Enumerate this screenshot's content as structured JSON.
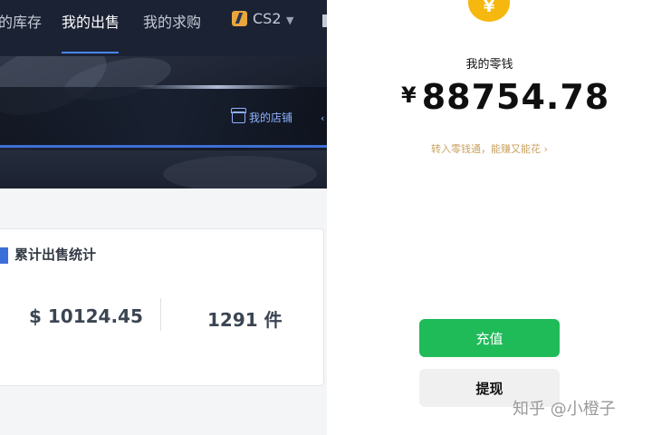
{
  "left_panel": {
    "nav": {
      "items": [
        "的库存",
        "我的出售",
        "我的求购"
      ],
      "active_index": 1,
      "game_selector": "CS2"
    },
    "banner": {
      "shop_link": "我的店铺"
    },
    "stats_card": {
      "title": "累计出售统计",
      "total_amount": "$ 10124.45",
      "total_count": "1291 件"
    }
  },
  "right_panel": {
    "coin_symbol": "¥",
    "wallet_label": "我的零钱",
    "balance_currency": "¥",
    "balance_amount": "88754.78",
    "promo_link": "转入零钱通，能赚又能花 ›",
    "buttons": {
      "recharge": "充值",
      "withdraw": "提现"
    },
    "watermark": "知乎 @小橙子"
  },
  "colors": {
    "nav_bg": "#1b2233",
    "accent_blue": "#3d6fd8",
    "wechat_green": "#1fbb59",
    "coin_yellow": "#f6b80e",
    "promo_gold": "#c9a262"
  }
}
